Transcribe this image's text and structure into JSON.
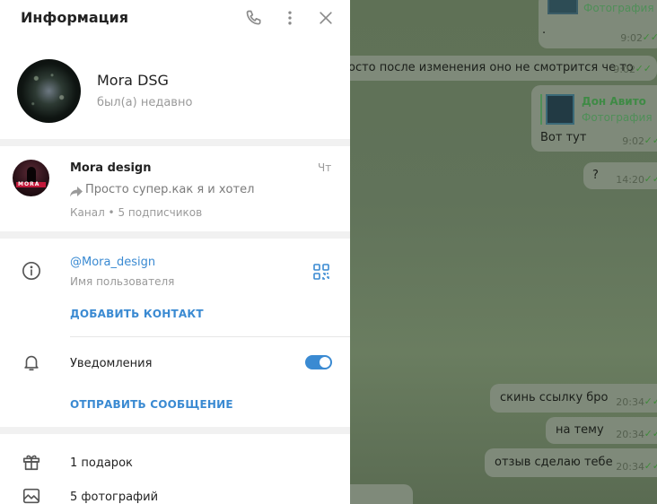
{
  "panel": {
    "title": "Информация",
    "header_icons": [
      "phone-icon",
      "more-vert-icon",
      "close-icon"
    ]
  },
  "profile": {
    "name": "Mora DSG",
    "status": "был(а) недавно"
  },
  "channel": {
    "title": "Mora design",
    "day": "Чт",
    "last_message": "Просто супер.как я и хотел",
    "meta": "Канал • 5 подписчиков",
    "avatar_text": "MORA"
  },
  "info": {
    "username": "@Mora_design",
    "username_label": "Имя пользователя",
    "add_contact": "ДОБАВИТЬ КОНТАКТ",
    "notifications_label": "Уведомления",
    "notifications_on": true,
    "send_message": "ОТПРАВИТЬ СООБЩЕНИЕ"
  },
  "media": {
    "gifts": "1 подарок",
    "photos": "5 фотографий"
  },
  "chat": {
    "msg_dot": ".",
    "msg_dot_time": "9:02",
    "msg_long": "осто после изменения оно не смотрится че то",
    "msg_long_time": "9:02",
    "forward_from": "Дон Авито",
    "forward_type": "Фотография",
    "forward_top_type": "Фотография",
    "msg_here": "Вот тут",
    "msg_here_time": "9:02",
    "msg_q": "?",
    "msg_q_time": "14:20",
    "msg_link": "скинь ссылку бро",
    "msg_link_time": "20:34",
    "msg_topic": "на тему",
    "msg_topic_time": "20:34",
    "msg_review": "отзыв сделаю тебе",
    "msg_review_time": "20:34",
    "ticks": "✓✓"
  },
  "colors": {
    "accent": "#3a8ad2",
    "panel_bg": "#ffffff",
    "chat_bg": "#61735a"
  }
}
